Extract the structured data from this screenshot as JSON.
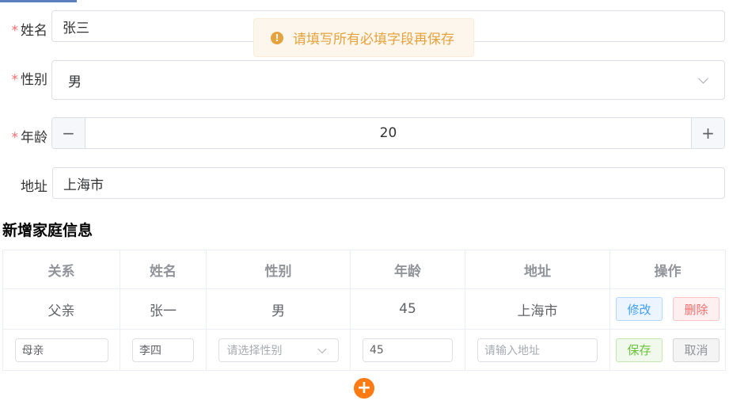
{
  "form": {
    "name": {
      "label": "姓名",
      "value": "张三",
      "required": "*"
    },
    "gender": {
      "label": "性别",
      "value": "男",
      "required": "*"
    },
    "age": {
      "label": "年龄",
      "value": "20",
      "required": "*",
      "minus": "−",
      "plus": "+"
    },
    "address": {
      "label": "地址",
      "value": "上海市"
    }
  },
  "toast": {
    "icon": "!",
    "text": "请填写所有必填字段再保存",
    "icon_name": "warning-icon",
    "color": "#e6a23c"
  },
  "section": {
    "title": "新增家庭信息"
  },
  "table": {
    "headers": [
      "关系",
      "姓名",
      "性别",
      "年龄",
      "地址",
      "操作"
    ],
    "row1": {
      "relation": "父亲",
      "name": "张一",
      "gender": "男",
      "age": "45",
      "address": "上海市",
      "edit": "修改",
      "delete": "删除"
    },
    "row2": {
      "relation": "母亲",
      "name": "李四",
      "gender_placeholder": "请选择性别",
      "age": "45",
      "address_placeholder": "请输入地址",
      "save": "保存",
      "cancel": "取消"
    }
  },
  "add_button": {
    "symbol": "+",
    "color": "#ff7a12"
  }
}
